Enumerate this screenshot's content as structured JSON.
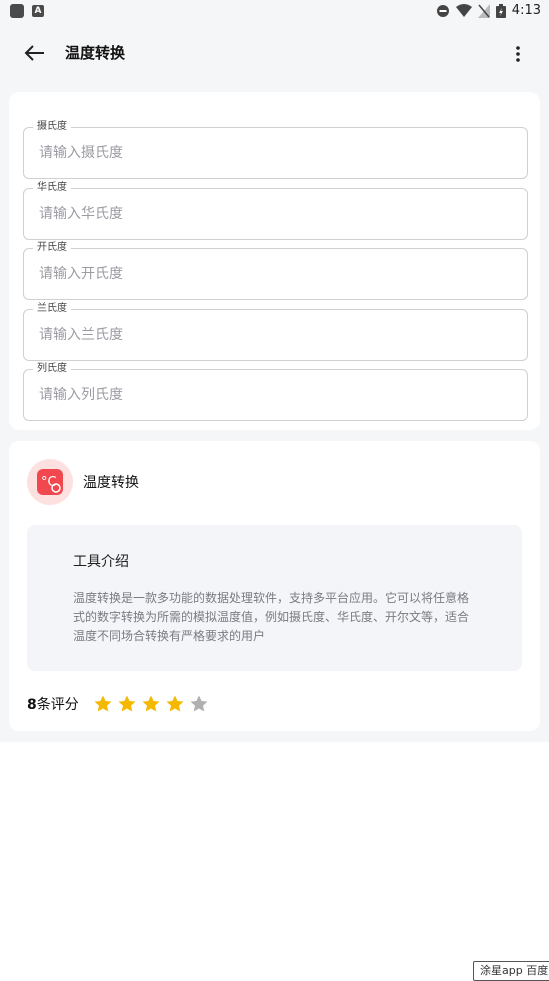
{
  "status_bar": {
    "time": "4:13",
    "app_glyph": "A"
  },
  "app_bar": {
    "title": "温度转换"
  },
  "form": {
    "fields": [
      {
        "label": "摄氏度",
        "placeholder": "请输入摄氏度",
        "value": ""
      },
      {
        "label": "华氏度",
        "placeholder": "请输入华氏度",
        "value": ""
      },
      {
        "label": "开氏度",
        "placeholder": "请输入开氏度",
        "value": ""
      },
      {
        "label": "兰氏度",
        "placeholder": "请输入兰氏度",
        "value": ""
      },
      {
        "label": "列氏度",
        "placeholder": "请输入列氏度",
        "value": ""
      }
    ]
  },
  "app_info": {
    "name": "温度转换",
    "intro_title": "工具介绍",
    "intro_text": "温度转换是一款多功能的数据处理软件，支持多平台应用。它可以将任意格式的数字转换为所需的模拟温度值，例如摄氏度、华氏度、开尔文等，适合温度不同场合转换有严格要求的用户",
    "rating_count": "8",
    "rating_suffix": "条评分",
    "rating_value": 4,
    "rating_max": 5
  },
  "colors": {
    "star_on": "#f5b800",
    "star_off": "#b0b0b0",
    "accent": "#f0484e"
  },
  "watermark": "涂星app 百度"
}
